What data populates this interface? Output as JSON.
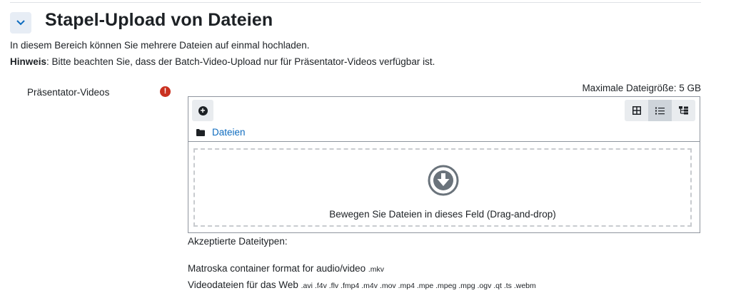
{
  "section": {
    "title": "Stapel-Upload von Dateien",
    "description": "In diesem Bereich können Sie mehrere Dateien auf einmal hochladen.",
    "note_label": "Hinweis",
    "note_text": ": Bitte beachten Sie, dass der Batch-Video-Upload nur für Präsentator-Videos verfügbar ist."
  },
  "field": {
    "label": "Präsentator-Videos",
    "required_glyph": "!",
    "max_size": "Maximale Dateigröße: 5 GB"
  },
  "filemanager": {
    "add_glyph": "+",
    "path_label": "Dateien",
    "drop_text": "Bewegen Sie Dateien in dieses Feld (Drag-and-drop)",
    "active_view": "list",
    "icons": [
      "plus-circle-icon",
      "grid-view-icon",
      "list-view-icon",
      "tree-view-icon",
      "folder-icon",
      "download-circle-icon",
      "chevron-down-icon",
      "exclamation-icon"
    ]
  },
  "accepted": {
    "label": "Akzeptierte Dateitypen:",
    "types": [
      {
        "name": "Matroska container format for audio/video",
        "exts": ".mkv"
      },
      {
        "name": "Videodateien für das Web",
        "exts": ".avi .f4v .flv .fmp4 .m4v .mov .mp4 .mpe .mpeg .mpg .ogv .qt .ts .webm"
      }
    ]
  },
  "colors": {
    "accent": "#0f6cbf",
    "required": "#ca3120",
    "border": "#8f959e",
    "dashed": "#c8cbcf"
  }
}
